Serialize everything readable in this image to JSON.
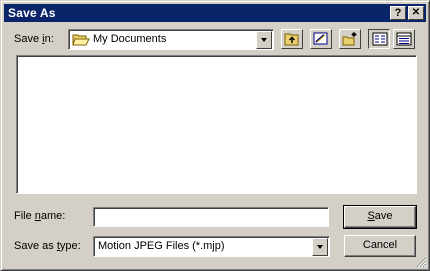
{
  "window": {
    "title": "Save As",
    "help_btn": "?",
    "close_btn": "✕"
  },
  "save_in": {
    "label_prefix": "Save ",
    "label_accel": "i",
    "label_suffix": "n:",
    "value": "My Documents",
    "folder_icon": "open-folder-icon"
  },
  "toolbar": {
    "icons": [
      "up-one-level-icon",
      "desktop-icon",
      "new-folder-icon",
      "list-view-icon",
      "details-view-icon"
    ]
  },
  "file_name": {
    "label_prefix": "File ",
    "label_accel": "n",
    "label_suffix": "ame:",
    "value": ""
  },
  "save_as_type": {
    "label_prefix": "Save as ",
    "label_accel": "t",
    "label_suffix": "ype:",
    "value": "Motion JPEG Files (*.mjp)"
  },
  "buttons": {
    "save_accel": "S",
    "save_rest": "ave",
    "cancel": "Cancel"
  },
  "colors": {
    "title_bg": "#0a246a",
    "face": "#d4d0c8"
  }
}
